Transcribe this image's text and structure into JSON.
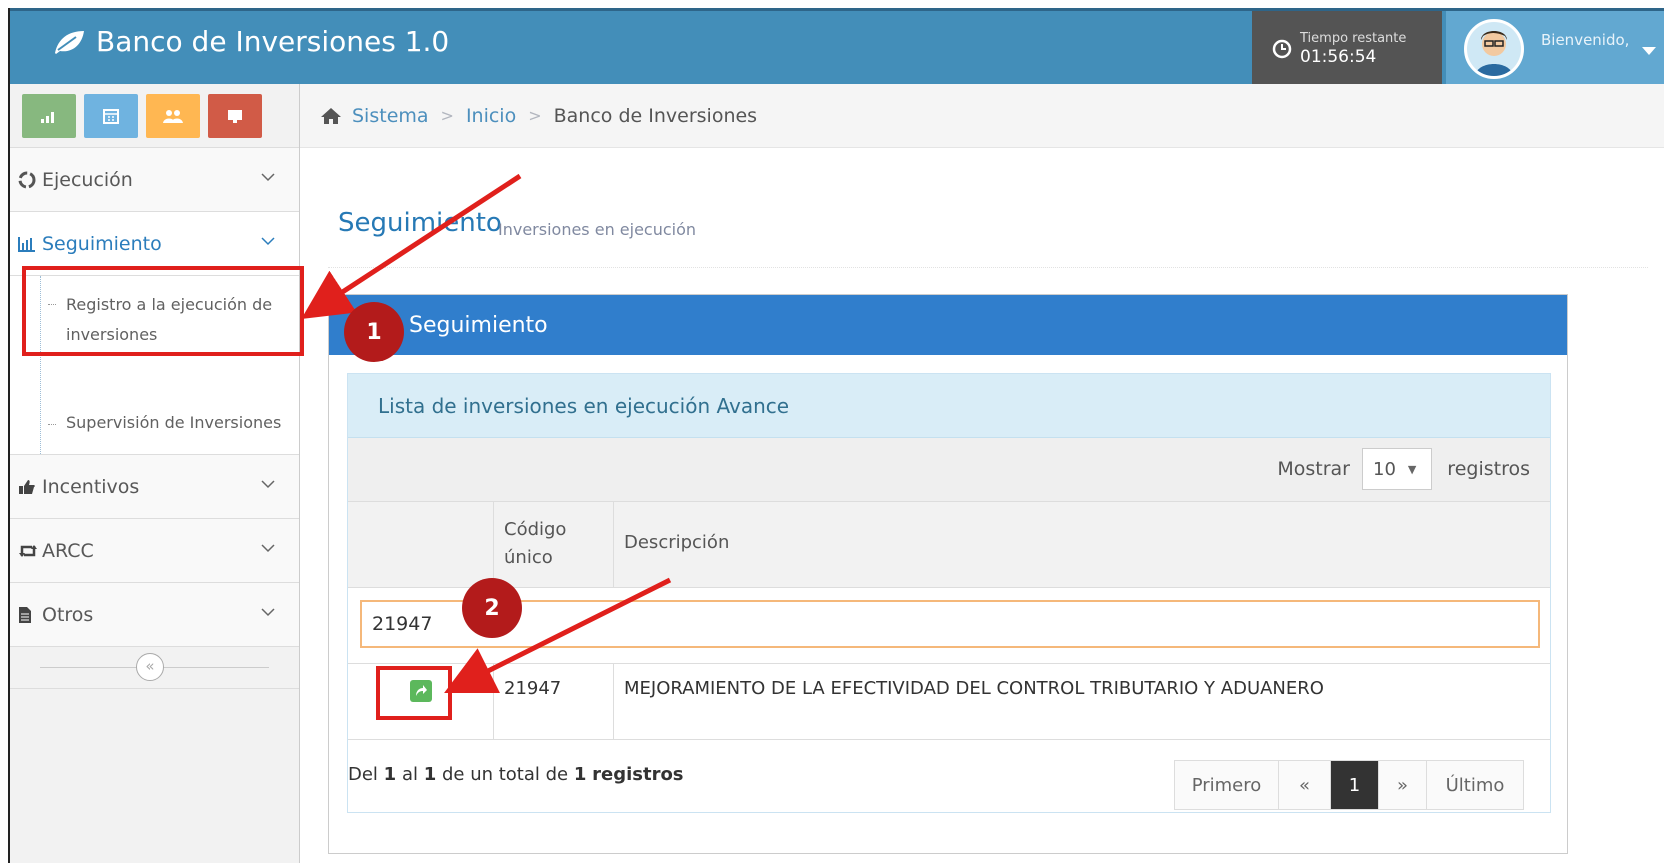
{
  "app": {
    "title": "Banco de Inversiones 1.0",
    "timer_label": "Tiempo restante",
    "timer_value": "01:56:54",
    "welcome": "Bienvenido,"
  },
  "breadcrumb": {
    "items": [
      "Sistema",
      "Inicio",
      "Banco de Inversiones"
    ]
  },
  "sidebar": {
    "shortcuts": [
      "chart-icon",
      "calendar-icon",
      "users-icon",
      "monitor-icon"
    ],
    "items": [
      {
        "label": "Ejecución",
        "icon": "recycle-icon"
      },
      {
        "label": "Seguimiento",
        "icon": "bar-chart-icon"
      },
      {
        "label": "Incentivos",
        "icon": "thumbs-up-icon"
      },
      {
        "label": "ARCC",
        "icon": "retweet-icon"
      },
      {
        "label": "Otros",
        "icon": "file-icon"
      }
    ],
    "sub_items": [
      "Registro a la ejecución de inversiones",
      "Supervisión de Inversiones"
    ],
    "collapse_symbol": "«"
  },
  "page": {
    "title": "Seguimiento",
    "subtitle": "Inversiones en ejecución"
  },
  "widget": {
    "title": "Seguimiento"
  },
  "panel": {
    "title": "Lista de inversiones en ejecución Avance",
    "show_label": "Mostrar",
    "page_size": "10",
    "records_label": "registros",
    "columns": [
      "",
      "Código único",
      "Descripción"
    ],
    "filter_value": "21947",
    "rows": [
      {
        "code": "21947",
        "description": "MEJORAMIENTO DE LA EFECTIVIDAD DEL CONTROL TRIBUTARIO Y ADUANERO"
      }
    ],
    "footer": {
      "del": "Del",
      "from": "1",
      "al": "al",
      "to": "1",
      "de_total": "de un total de",
      "total": "1",
      "registros": "registros"
    },
    "pager": [
      "Primero",
      "«",
      "1",
      "»",
      "Último"
    ]
  },
  "annotations": {
    "step1": "1",
    "step2": "2",
    "color": "#e0201c",
    "badge_color": "#b31b1b"
  },
  "colors": {
    "topbar": "#438eb9",
    "widget_head": "#307ecc",
    "panel_head": "#d9edf7",
    "link": "#4c8fbd"
  }
}
